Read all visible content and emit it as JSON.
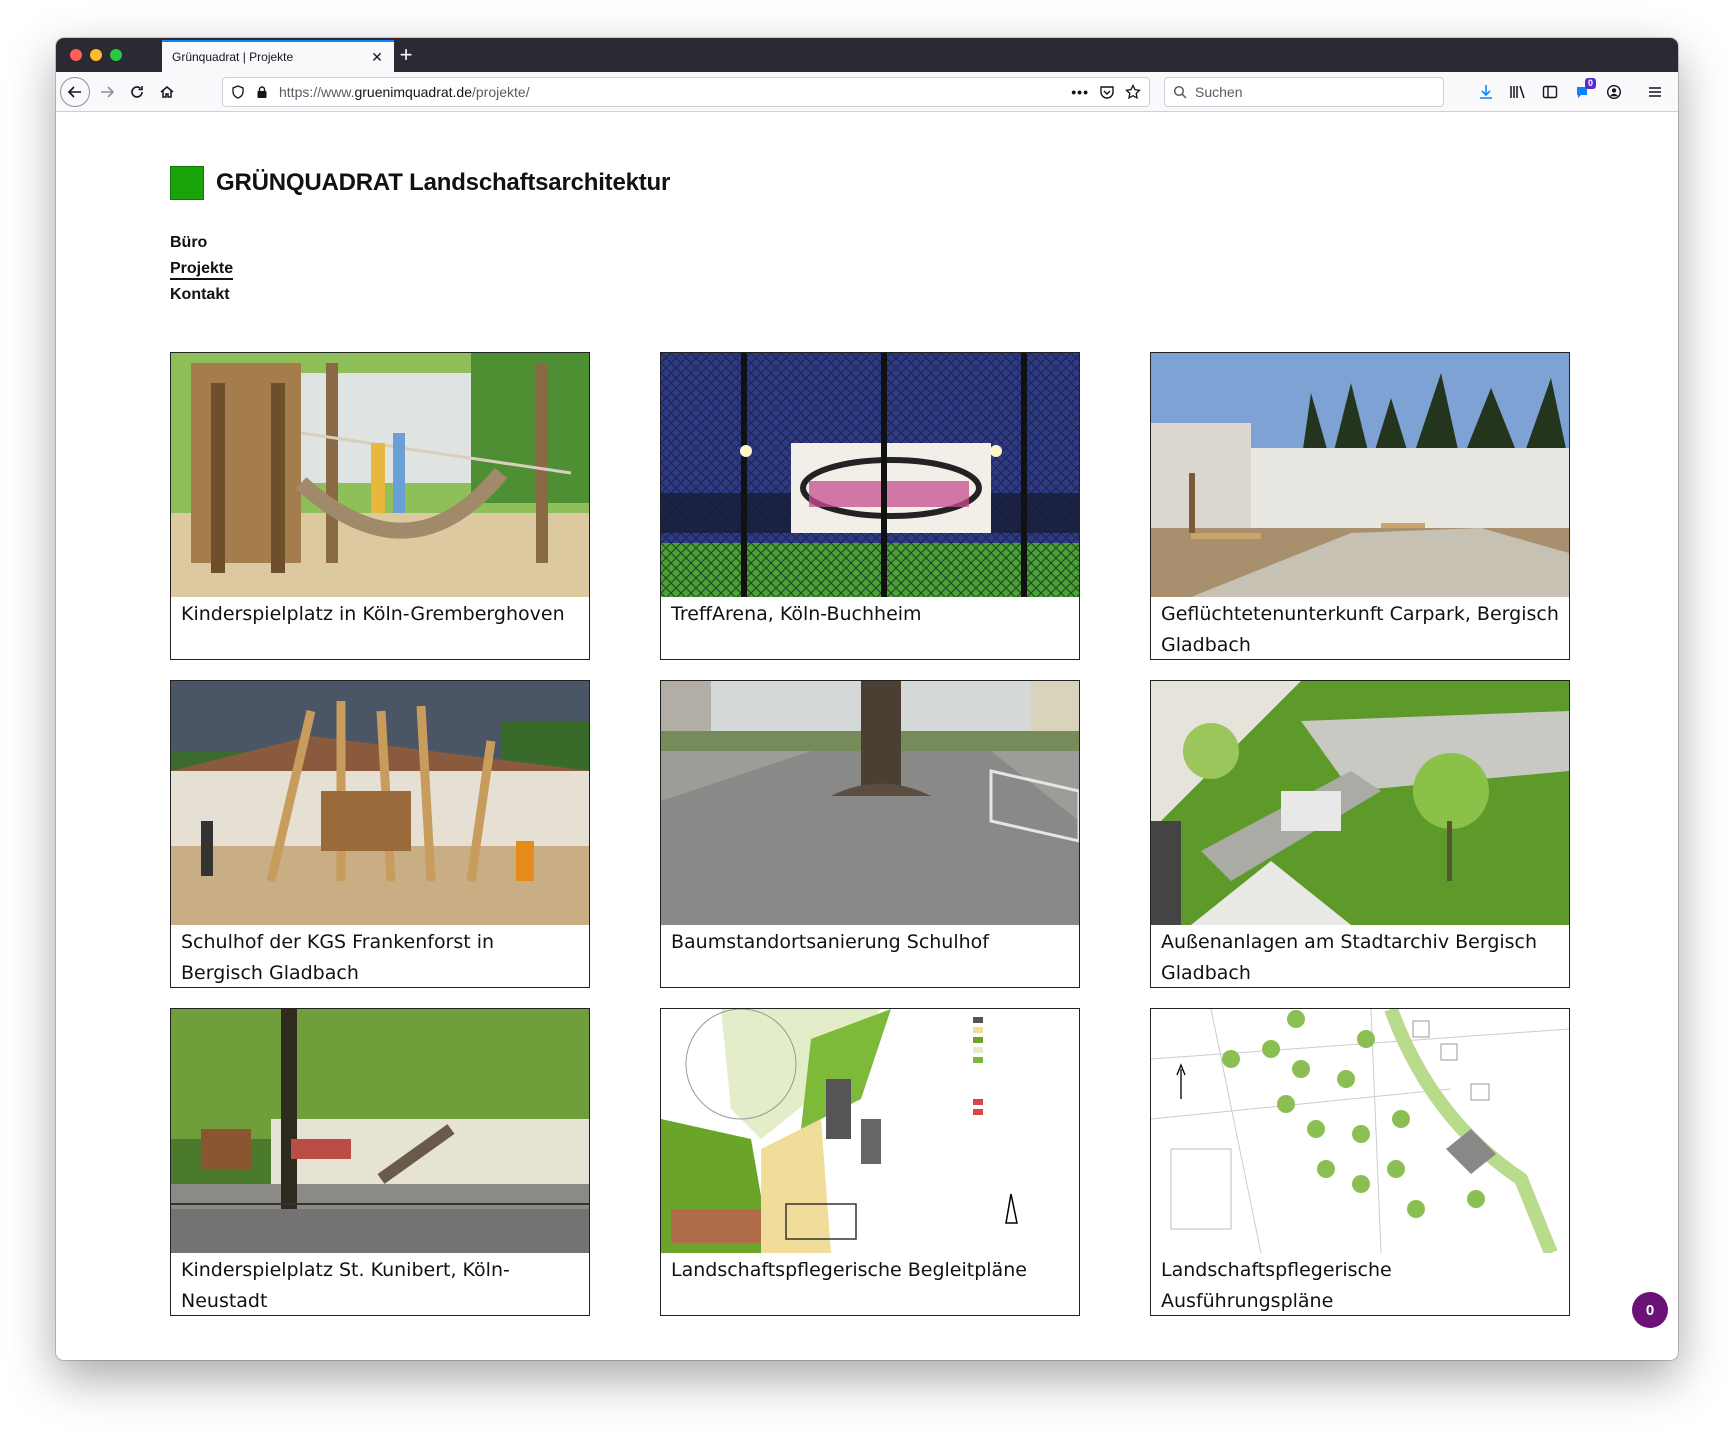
{
  "browser": {
    "tab_title": "Grünquadrat | Projekte",
    "url_prefix": "https://www.",
    "url_domain": "gruenimquadrat.de",
    "url_path": "/projekte/",
    "search_placeholder": "Suchen",
    "notification_count": "0"
  },
  "site": {
    "title": "GRÜNQUADRAT Landschaftsarchitektur",
    "brand_color": "#1aa40a"
  },
  "nav": {
    "items": [
      {
        "label": "Büro",
        "active": false
      },
      {
        "label": "Projekte",
        "active": true
      },
      {
        "label": "Kontakt",
        "active": false
      }
    ]
  },
  "projects": [
    {
      "caption": "Kinderspielplatz in Köln-Gremberghoven",
      "image": "playground-wooden-climbing-photo"
    },
    {
      "caption": "TreffArena, Köln-Buchheim",
      "image": "sports-cage-banner-photo"
    },
    {
      "caption": "Geflüchtetenunterkunft Carpark, Bergisch Gladbach",
      "image": "container-housing-photo"
    },
    {
      "caption": "Schulhof der KGS Frankenforst in Bergisch Gladbach",
      "image": "schoolyard-climbing-frame-photo"
    },
    {
      "caption": "Baumstandortsanierung Schulhof",
      "image": "tree-asphalt-schoolyard-photo"
    },
    {
      "caption": "Außenanlagen am Stadtarchiv Bergisch Gladbach",
      "image": "archive-garden-aerial-photo"
    },
    {
      "caption": "Kinderspielplatz St. Kunibert, Köln-Neustadt",
      "image": "park-playground-photo"
    },
    {
      "caption": "Landschaftspflegerische Begleitpläne",
      "image": "landscape-plan-drawing"
    },
    {
      "caption": "Landschaftspflegerische Ausführungspläne",
      "image": "execution-plan-drawing"
    }
  ],
  "chat_badge": "0",
  "colors": {
    "accent": "#0a84ff",
    "chat_badge": "#6b1276"
  }
}
